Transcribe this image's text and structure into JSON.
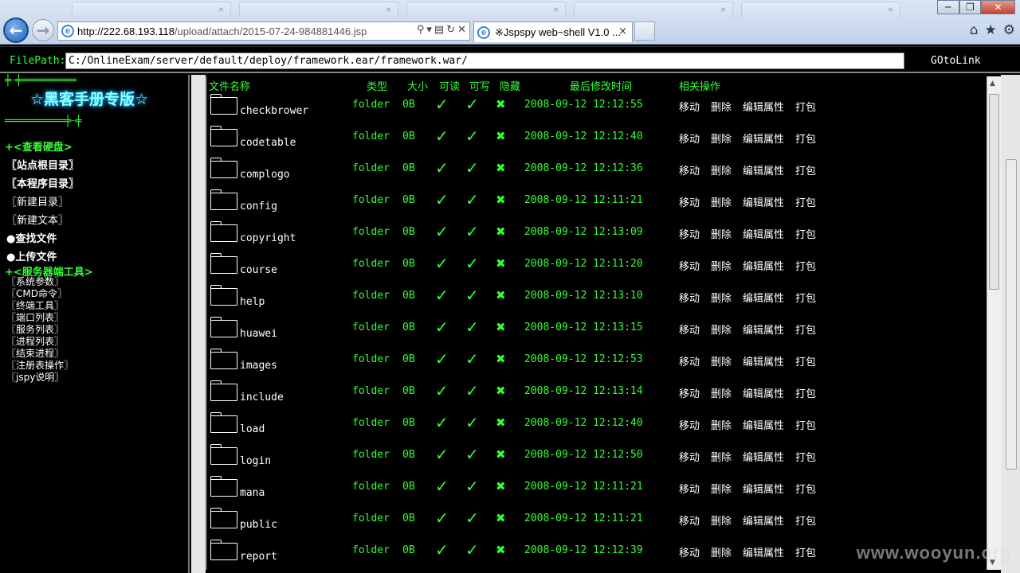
{
  "browser": {
    "address": "http://222.68.193.118/upload/attach/2015-07-24-984881446.jsp",
    "address_host": "http://222.68.193.118",
    "address_path": "/upload/attach/2015-07-24-984881446.jsp",
    "tab_title": "※Jspspy web~shell V1.0 ...",
    "tab_close": "×",
    "window_buttons": {
      "minimize": "─",
      "restore": "❐",
      "close": "✕"
    },
    "icons": [
      "back-icon",
      "forward-icon",
      "ie-page-icon",
      "search-icon",
      "compat-icon",
      "refresh-icon",
      "stop-icon",
      "home-icon",
      "favorites-star-icon",
      "tools-gear-icon"
    ]
  },
  "pathbar": {
    "label": "FilePath:",
    "value": "C:/OnlineExam/server/default/deploy/framework.ear/framework.war/",
    "goto": "GOtoLink"
  },
  "sidebar": {
    "deco_top": "╪┈╪══════════",
    "brand": "☆黑客手册专版☆",
    "deco_bottom": "═══════════╪┈╪",
    "disk_section": "+<查看硬盘>",
    "links": [
      {
        "label": "〖站点根目录〗",
        "bold": true
      },
      {
        "label": "〖本程序目录〗",
        "bold": true
      },
      {
        "label": "〖新建目录〗",
        "bold": false
      },
      {
        "label": "〖新建文本〗",
        "bold": false
      },
      {
        "label": "●查找文件",
        "bold": true
      },
      {
        "label": "●上传文件",
        "bold": true
      }
    ],
    "tools_section": "+<服务器端工具>",
    "tools": [
      "〖系统参数〗",
      "〖CMD命令〗",
      "〖终端工具〗",
      "〖端口列表〗",
      "〖服务列表〗",
      "〖进程列表〗",
      "〖结束进程〗",
      "〖注册表操作〗",
      "〖jspy说明〗"
    ]
  },
  "table": {
    "headers": {
      "name": "文件名称",
      "type": "类型",
      "size": "大小",
      "read": "可读",
      "write": "可写",
      "hidden": "隐藏",
      "mtime": "最后修改时间",
      "ops": "相关操作"
    },
    "ops": [
      "移动",
      "删除",
      "编辑属性",
      "打包"
    ],
    "check": "✓",
    "cross": "✖",
    "rows": [
      {
        "name": "checkbrower",
        "type": "folder",
        "size": "0B",
        "mtime": "2008-09-12 12:12:55"
      },
      {
        "name": "codetable",
        "type": "folder",
        "size": "0B",
        "mtime": "2008-09-12 12:12:40"
      },
      {
        "name": "complogo",
        "type": "folder",
        "size": "0B",
        "mtime": "2008-09-12 12:12:36"
      },
      {
        "name": "config",
        "type": "folder",
        "size": "0B",
        "mtime": "2008-09-12 12:11:21"
      },
      {
        "name": "copyright",
        "type": "folder",
        "size": "0B",
        "mtime": "2008-09-12 12:13:09"
      },
      {
        "name": "course",
        "type": "folder",
        "size": "0B",
        "mtime": "2008-09-12 12:11:20"
      },
      {
        "name": "help",
        "type": "folder",
        "size": "0B",
        "mtime": "2008-09-12 12:13:10"
      },
      {
        "name": "huawei",
        "type": "folder",
        "size": "0B",
        "mtime": "2008-09-12 12:13:15"
      },
      {
        "name": "images",
        "type": "folder",
        "size": "0B",
        "mtime": "2008-09-12 12:12:53"
      },
      {
        "name": "include",
        "type": "folder",
        "size": "0B",
        "mtime": "2008-09-12 12:13:14"
      },
      {
        "name": "load",
        "type": "folder",
        "size": "0B",
        "mtime": "2008-09-12 12:12:40"
      },
      {
        "name": "login",
        "type": "folder",
        "size": "0B",
        "mtime": "2008-09-12 12:12:50"
      },
      {
        "name": "mana",
        "type": "folder",
        "size": "0B",
        "mtime": "2008-09-12 12:11:21"
      },
      {
        "name": "public",
        "type": "folder",
        "size": "0B",
        "mtime": "2008-09-12 12:11:21"
      },
      {
        "name": "report",
        "type": "folder",
        "size": "0B",
        "mtime": "2008-09-12 12:12:39"
      }
    ]
  },
  "watermark": "www.wooyun.org",
  "colors": {
    "green": "#33ff33",
    "brand_glow": "#00ccff",
    "background": "#000000"
  }
}
